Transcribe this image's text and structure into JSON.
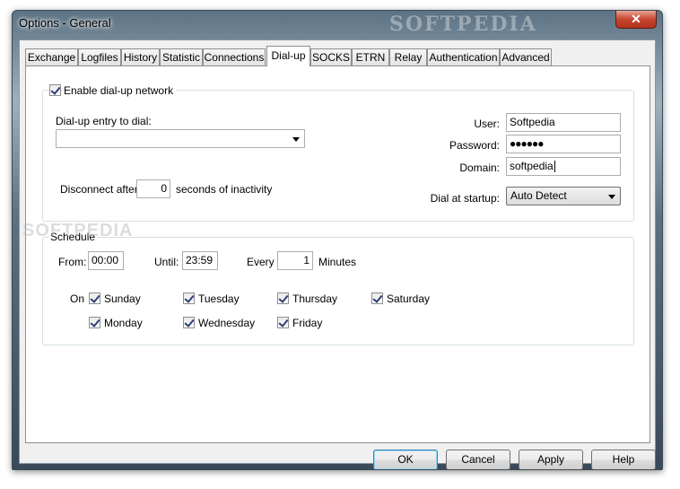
{
  "window": {
    "title": "Options - General",
    "watermark": "SOFTPEDIA",
    "close_label": "✕"
  },
  "tabs": [
    {
      "label": "Exchange"
    },
    {
      "label": "Logfiles"
    },
    {
      "label": "History"
    },
    {
      "label": "Statistic"
    },
    {
      "label": "Connections"
    },
    {
      "label": "Dial-up",
      "active": true
    },
    {
      "label": "SOCKS"
    },
    {
      "label": "ETRN"
    },
    {
      "label": "Relay"
    },
    {
      "label": "Authentication"
    },
    {
      "label": "Advanced"
    }
  ],
  "dialup": {
    "enable_label": "Enable dial-up network",
    "enable_checked": true,
    "entry_label": "Dial-up entry to dial:",
    "entry_value": "",
    "disconnect_label": "Disconnect after",
    "disconnect_value": "0",
    "inactivity_label": "seconds of inactivity",
    "user_label": "User:",
    "user_value": "Softpedia",
    "password_label": "Password:",
    "password_value": "●●●●●●",
    "domain_label": "Domain:",
    "domain_value": "softpedia",
    "startup_label": "Dial at startup:",
    "startup_value": "Auto Detect"
  },
  "schedule": {
    "legend": "Schedule",
    "from_label": "From:",
    "from_value": "00:00",
    "until_label": "Until:",
    "until_value": "23:59",
    "every_label": "Every",
    "every_value": "1",
    "minutes_label": "Minutes",
    "on_label": "On",
    "days": {
      "sunday": "Sunday",
      "monday": "Monday",
      "tuesday": "Tuesday",
      "wednesday": "Wednesday",
      "thursday": "Thursday",
      "friday": "Friday",
      "saturday": "Saturday"
    }
  },
  "buttons": {
    "ok": "OK",
    "cancel": "Cancel",
    "apply": "Apply",
    "help": "Help"
  },
  "watermark_text": "SOFTPEDIA"
}
